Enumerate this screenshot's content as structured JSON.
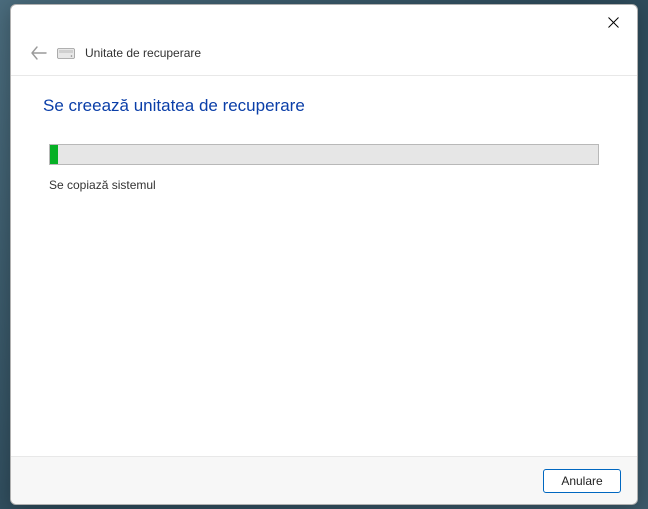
{
  "window": {
    "title": "Unitate de recuperare"
  },
  "content": {
    "heading": "Se creează unitatea de recuperare",
    "status_text": "Se copiază sistemul",
    "progress_percent": 1.5
  },
  "footer": {
    "cancel_label": "Anulare"
  },
  "colors": {
    "heading": "#0a3ea8",
    "progress_fill": "#06b025"
  }
}
